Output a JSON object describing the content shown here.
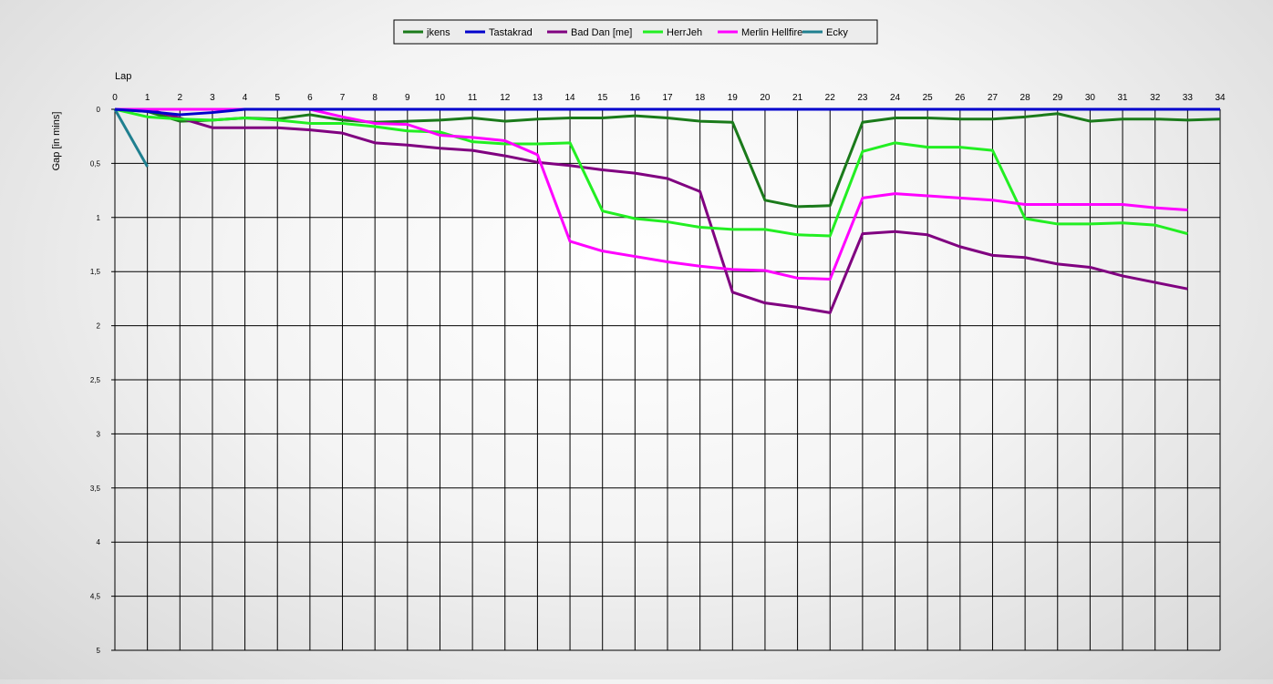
{
  "chart_data": {
    "type": "line",
    "title": "",
    "xlabel": "Lap",
    "ylabel": "Gap [in mins]",
    "x": [
      0,
      1,
      2,
      3,
      4,
      5,
      6,
      7,
      8,
      9,
      10,
      11,
      12,
      13,
      14,
      15,
      16,
      17,
      18,
      19,
      20,
      21,
      22,
      23,
      24,
      25,
      26,
      27,
      28,
      29,
      30,
      31,
      32,
      33,
      34
    ],
    "xlim": [
      0,
      34
    ],
    "ylim": [
      0,
      5
    ],
    "y_inverted": true,
    "y_tick_labels": [
      "0",
      "0,5",
      "1",
      "1,5",
      "2",
      "2,5",
      "3",
      "3,5",
      "4",
      "4,5",
      "5"
    ],
    "grid": true,
    "legend_position": "top-center",
    "series": [
      {
        "name": "jkens",
        "color": "#1a7a1a",
        "values": [
          0,
          0.02,
          0.11,
          0.1,
          0.08,
          0.09,
          0.05,
          0.1,
          0.12,
          0.11,
          0.1,
          0.08,
          0.11,
          0.09,
          0.08,
          0.08,
          0.06,
          0.08,
          0.11,
          0.12,
          0.84,
          0.9,
          0.89,
          0.12,
          0.08,
          0.08,
          0.09,
          0.09,
          0.07,
          0.04,
          0.11,
          0.09,
          0.09,
          0.1,
          0.09
        ]
      },
      {
        "name": "Tastakrad",
        "color": "#0000cc",
        "values": [
          0,
          0.02,
          0.05,
          0.03,
          0,
          0,
          0,
          0,
          0,
          0,
          0,
          0,
          0,
          0,
          0,
          0,
          0,
          0,
          0,
          0,
          0,
          0,
          0,
          0,
          0,
          0,
          0,
          0,
          0,
          0,
          0,
          0,
          0,
          0,
          0
        ]
      },
      {
        "name": "Bad Dan [me]",
        "color": "#800080",
        "values": [
          0,
          0,
          0.08,
          0.17,
          0.17,
          0.17,
          0.19,
          0.22,
          0.31,
          0.33,
          0.36,
          0.38,
          0.43,
          0.49,
          0.52,
          0.56,
          0.59,
          0.64,
          0.76,
          1.69,
          1.79,
          1.83,
          1.88,
          1.15,
          1.13,
          1.16,
          1.27,
          1.35,
          1.37,
          1.43,
          1.46,
          1.54,
          1.6,
          1.66
        ]
      },
      {
        "name": "HerrJeh",
        "color": "#22ee22",
        "values": [
          0,
          0.07,
          0.09,
          0.1,
          0.08,
          0.1,
          0.13,
          0.13,
          0.16,
          0.2,
          0.21,
          0.3,
          0.32,
          0.32,
          0.31,
          0.94,
          1.01,
          1.04,
          1.09,
          1.11,
          1.11,
          1.16,
          1.17,
          0.39,
          0.31,
          0.35,
          0.35,
          0.38,
          1.01,
          1.06,
          1.06,
          1.05,
          1.07,
          1.15
        ]
      },
      {
        "name": "Merlin Hellfire",
        "color": "#ff00ff",
        "values": [
          0,
          0,
          0,
          0,
          0,
          0,
          0,
          0.07,
          0.13,
          0.14,
          0.24,
          0.26,
          0.29,
          0.42,
          1.22,
          1.31,
          1.36,
          1.41,
          1.45,
          1.48,
          1.49,
          1.56,
          1.57,
          0.82,
          0.78,
          0.8,
          0.82,
          0.84,
          0.88,
          0.88,
          0.88,
          0.88,
          0.91,
          0.93
        ]
      },
      {
        "name": "Ecky",
        "color": "#1f7f8f",
        "values": [
          0,
          0.53
        ]
      }
    ]
  }
}
